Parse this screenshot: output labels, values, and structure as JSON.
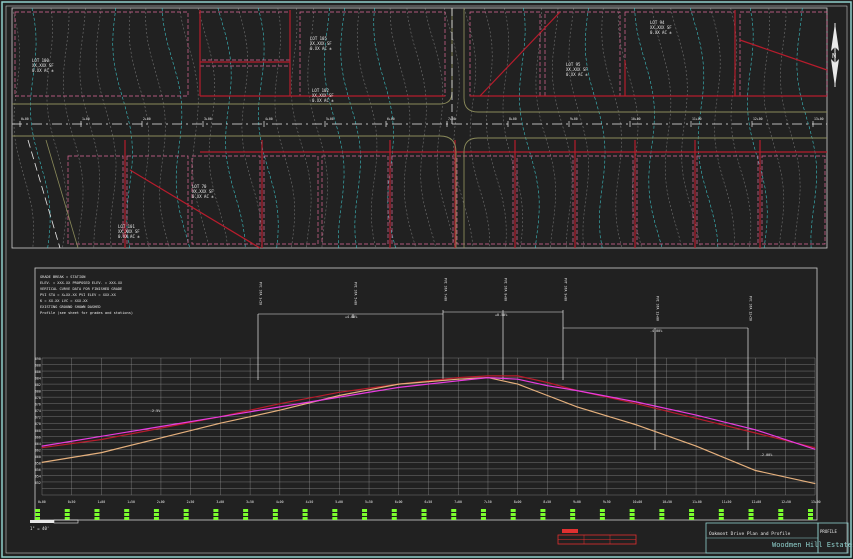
{
  "plan": {
    "lots": [
      {
        "id": "lot-105",
        "lines": [
          "LOT 105",
          "XX,XXX SF",
          "0.XX AC ±"
        ]
      },
      {
        "id": "lot-100",
        "lines": [
          "LOT 100",
          "XX,XXX SF",
          "0.XX AC ±"
        ]
      },
      {
        "id": "lot-102",
        "lines": [
          "LOT 102",
          "XX,XXX SF",
          "0.XX AC ±"
        ]
      },
      {
        "id": "lot-94",
        "lines": [
          "LOT 94",
          "XX,XXX SF",
          "0.XX AC ±"
        ]
      },
      {
        "id": "lot-95",
        "lines": [
          "LOT 95",
          "XX,XXX SF",
          "0.XX AC ±"
        ]
      },
      {
        "id": "lot-70",
        "lines": [
          "LOT 70",
          "XX,XXX SF",
          "0.XX AC ±"
        ]
      },
      {
        "id": "lot-101",
        "lines": [
          "LOT 101",
          "XX,XXX SF",
          "0.XX AC ±"
        ]
      }
    ],
    "stations": [
      "0+00",
      "1+00",
      "2+00",
      "3+00",
      "4+00",
      "5+00",
      "6+00",
      "7+00",
      "8+00",
      "9+00",
      "10+00",
      "11+00",
      "12+00",
      "13+00"
    ],
    "north_label": "N"
  },
  "profile": {
    "notes": [
      "GRADE BREAK = STATION",
      "ELEV. = XXX.XX   PROPOSED ELEV. = XXX.XX",
      "VERTICAL CURVE DATA FOR FINISHED GRADE",
      "PVI STA = X+XX.XX   PVI ELEV = XXX.XX",
      "K = XX.XX   LVC = XXX.XX",
      "EXISTING GROUND SHOWN DASHED",
      "Profile (see sheet for grades and stations)"
    ],
    "vpi_labels": [
      "PVC STA 3+50",
      "PVI STA 5+00",
      "PVI STA 7+00",
      "PVI STA 8+00",
      "PVT STA 9+00",
      "PVI STA 11+00",
      "PVC STA 12+50"
    ],
    "grade_labels": [
      "-2.5%",
      "+4.00%",
      "+0.50%",
      "-4.00%",
      "-2.00%"
    ],
    "elevations": [
      "690",
      "688",
      "686",
      "684",
      "682",
      "680",
      "678",
      "676",
      "674",
      "672",
      "670",
      "668",
      "666",
      "664",
      "662",
      "660",
      "658",
      "656",
      "654",
      "652"
    ],
    "stations": [
      "0+00",
      "0+50",
      "1+00",
      "1+50",
      "2+00",
      "2+50",
      "3+00",
      "3+50",
      "4+00",
      "4+50",
      "5+00",
      "5+50",
      "6+00",
      "6+50",
      "7+00",
      "7+50",
      "8+00",
      "8+50",
      "9+00",
      "9+50",
      "10+00",
      "10+50",
      "11+00",
      "11+50",
      "12+00",
      "12+50",
      "13+00"
    ],
    "scale_label": "1\" = 40'"
  },
  "title_block": {
    "sheet_title": "Oakmont Drive Plan and Profile",
    "project": "Woodmen Hill Estates",
    "sheet_no": "PROFILE"
  },
  "colors": {
    "background": "#212121",
    "lot_lines": "#b71c2c",
    "lot_dash": "#e06a98",
    "contours_cyan": "#3fd1d6",
    "contours_grey": "#b4b4b4",
    "finished_grade": "#e83ce0",
    "existing_ground": "#e5b07d",
    "frame": "#8fd0cc",
    "station_green": "#7cff2e"
  },
  "chart_data": {
    "type": "line",
    "title": "",
    "xlabel": "",
    "ylabel": "",
    "x": [
      0,
      100,
      200,
      300,
      350,
      400,
      500,
      600,
      700,
      750,
      800,
      850,
      900,
      1000,
      1100,
      1200,
      1300
    ],
    "series": [
      {
        "values": [
          664.5,
          667.0,
          670.5,
          674.0,
          676.0,
          678.0,
          681.5,
          684.0,
          686.0,
          686.5,
          686.5,
          684.5,
          682.0,
          678.0,
          673.5,
          669.0,
          664.5
        ]
      },
      {
        "values": [
          660.0,
          663.0,
          667.5,
          672.0,
          674.0,
          676.0,
          680.5,
          684.0,
          685.5,
          686.0,
          684.0,
          680.5,
          677.0,
          671.5,
          665.0,
          657.5,
          653.5
        ]
      },
      {
        "values": [
          665.0,
          668.0,
          671.0,
          674.0,
          675.5,
          677.0,
          680.0,
          683.0,
          685.0,
          686.0,
          685.5,
          683.5,
          682.0,
          678.5,
          674.5,
          670.0,
          664.0
        ]
      }
    ],
    "ylim": [
      650,
      692
    ],
    "xlim": [
      0,
      1300
    ],
    "grid": true
  }
}
